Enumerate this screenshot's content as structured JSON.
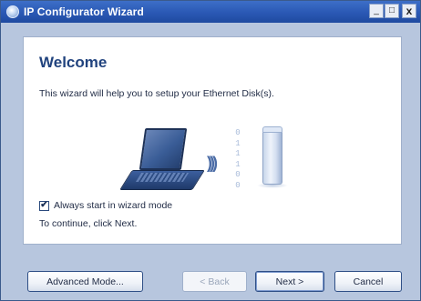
{
  "window": {
    "title": "IP Configurator Wizard",
    "controls": {
      "minimize": "_",
      "maximize": "□",
      "close": "x"
    }
  },
  "main": {
    "heading": "Welcome",
    "intro": "This wizard will help you to setup your Ethernet Disk(s).",
    "illustration": {
      "icons": [
        "laptop-icon",
        "wireless-waves-icon",
        "disk-icon"
      ],
      "binary_digits": [
        "0",
        "1",
        "1",
        "1",
        "0",
        "0"
      ],
      "waves": ")))"
    },
    "checkbox": {
      "label": "Always start in wizard mode",
      "checked": true,
      "mark": "✔"
    },
    "continue_text": "To continue, click Next."
  },
  "buttons": {
    "advanced": "Advanced Mode...",
    "back": "< Back",
    "next": "Next >",
    "cancel": "Cancel"
  },
  "colors": {
    "titlebar": "#2a58b4",
    "window_bg": "#b7c6de",
    "heading": "#21437e"
  }
}
